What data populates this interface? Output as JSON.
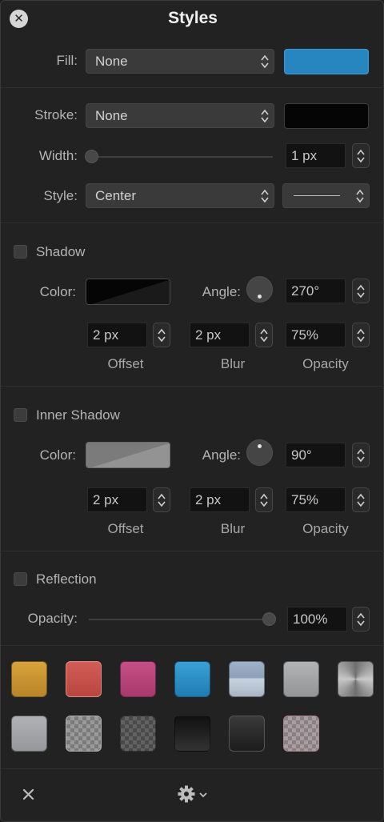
{
  "header": {
    "title": "Styles",
    "close_icon": "close-circle-icon"
  },
  "fill": {
    "label": "Fill:",
    "value": "None",
    "color": "#2786c0"
  },
  "stroke": {
    "label": "Stroke:",
    "value": "None",
    "color": "#050505",
    "width_label": "Width:",
    "width_value": "1 px",
    "style_label": "Style:",
    "style_value": "Center"
  },
  "shadow": {
    "label": "Shadow",
    "enabled": false,
    "color_label": "Color:",
    "angle_label": "Angle:",
    "angle_value": "270°",
    "offset_value": "2 px",
    "blur_value": "2 px",
    "opacity_value": "75%",
    "offset_caption": "Offset",
    "blur_caption": "Blur",
    "opacity_caption": "Opacity"
  },
  "inner_shadow": {
    "label": "Inner Shadow",
    "enabled": false,
    "color_label": "Color:",
    "angle_label": "Angle:",
    "angle_value": "90°",
    "offset_value": "2 px",
    "blur_value": "2 px",
    "opacity_value": "75%",
    "offset_caption": "Offset",
    "blur_caption": "Blur",
    "opacity_caption": "Opacity"
  },
  "reflection": {
    "label": "Reflection",
    "enabled": false,
    "opacity_label": "Opacity:",
    "opacity_value": "100%"
  },
  "presets": [
    {
      "name": "gold",
      "color": "#c9952c"
    },
    {
      "name": "red",
      "color": "#c4504a"
    },
    {
      "name": "pink",
      "color": "#b84479"
    },
    {
      "name": "blue",
      "color": "#2e8dc4"
    },
    {
      "name": "sky",
      "color": "#95a7bf"
    },
    {
      "name": "silver",
      "color": "#a4a5a7"
    },
    {
      "name": "metal",
      "color": "#8d8d8e"
    },
    {
      "name": "light-gray",
      "color": "#a2a4a7"
    },
    {
      "name": "checker-light",
      "color": "#8e8e8f"
    },
    {
      "name": "checker-dark",
      "color": "#5a5a5b"
    },
    {
      "name": "black-gradient",
      "color": "#1f1f1f"
    },
    {
      "name": "black-glossy",
      "color": "#2a2a2a"
    },
    {
      "name": "checker-pink",
      "color": "#9c8f92"
    }
  ],
  "footer": {
    "close_icon": "x-icon",
    "gear_icon": "gear-icon"
  }
}
